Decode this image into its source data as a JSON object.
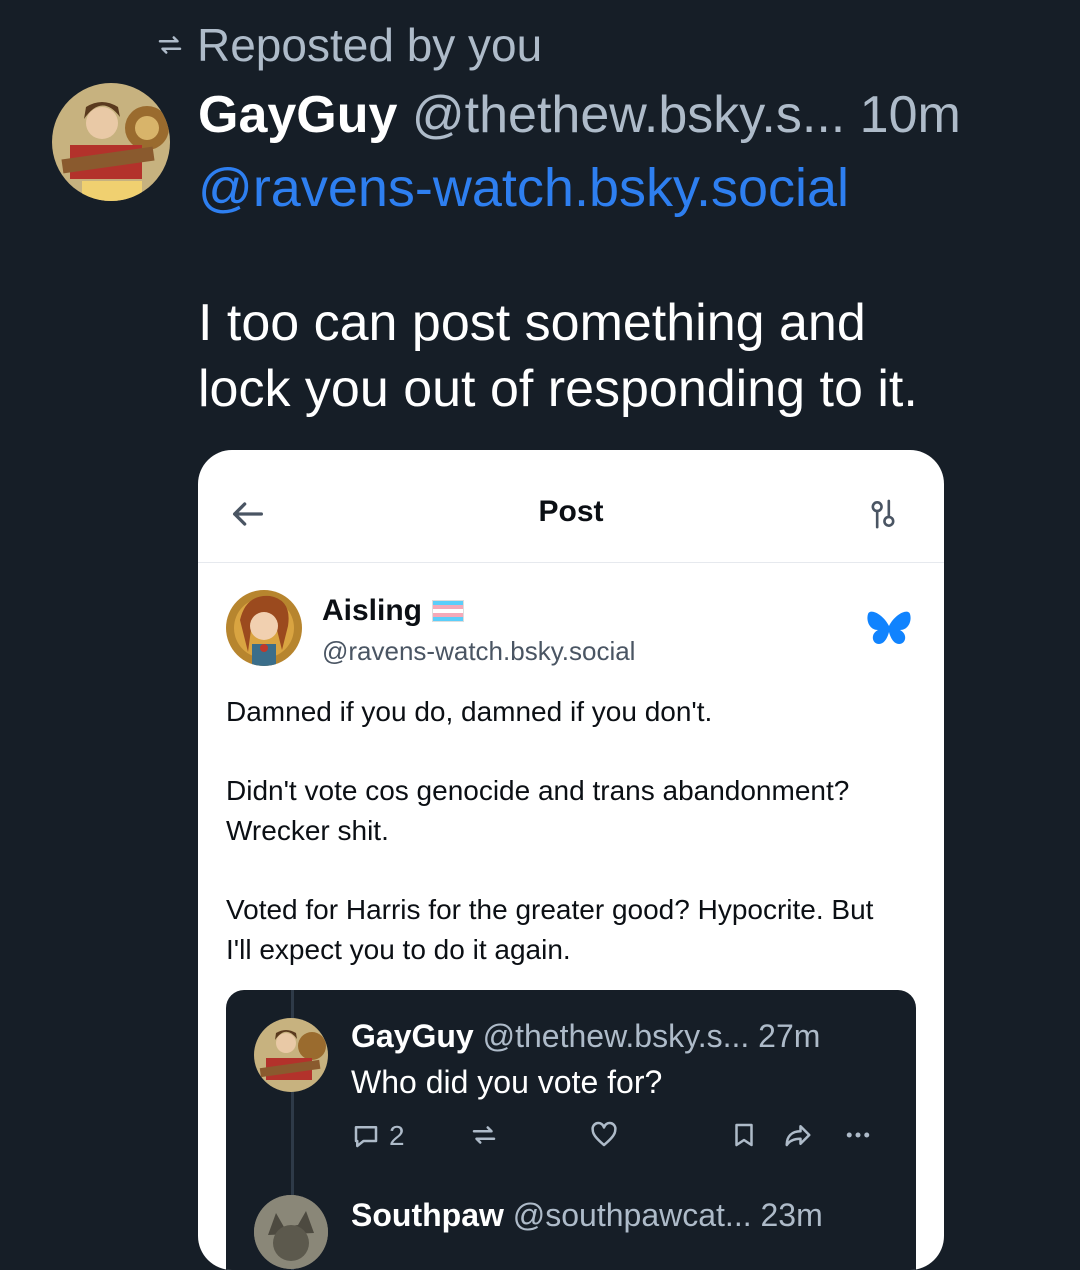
{
  "repost": {
    "label": "Reposted by you"
  },
  "post": {
    "author_name": "GayGuy",
    "author_handle": "@thethew.bsky.s...",
    "time": "10m",
    "mention": "@ravens-watch.bsky.social",
    "text_line1": "I too can post something and",
    "text_line2": "lock you out of responding to it."
  },
  "screenshot": {
    "title": "Post",
    "author_name": "Aisling",
    "author_handle": "@ravens-watch.bsky.social",
    "paragraphs": [
      "Damned if you do, damned if you don't.",
      "Didn't vote cos genocide and trans abandonment? Wrecker shit.",
      "Voted for Harris for the greater good? Hypocrite. But I'll expect you to do it again."
    ],
    "reply": {
      "author_name": "GayGuy",
      "meta": "@thethew.bsky.s... 27m",
      "text": "Who did you vote for?",
      "reply_count": "2"
    },
    "reply2": {
      "author_name": "Southpaw",
      "meta": "@southpawcat... 23m"
    }
  },
  "colors": {
    "background": "#161e27",
    "muted": "#aebbc9",
    "link": "#2e7ff0",
    "bluesky": "#1083fe"
  }
}
